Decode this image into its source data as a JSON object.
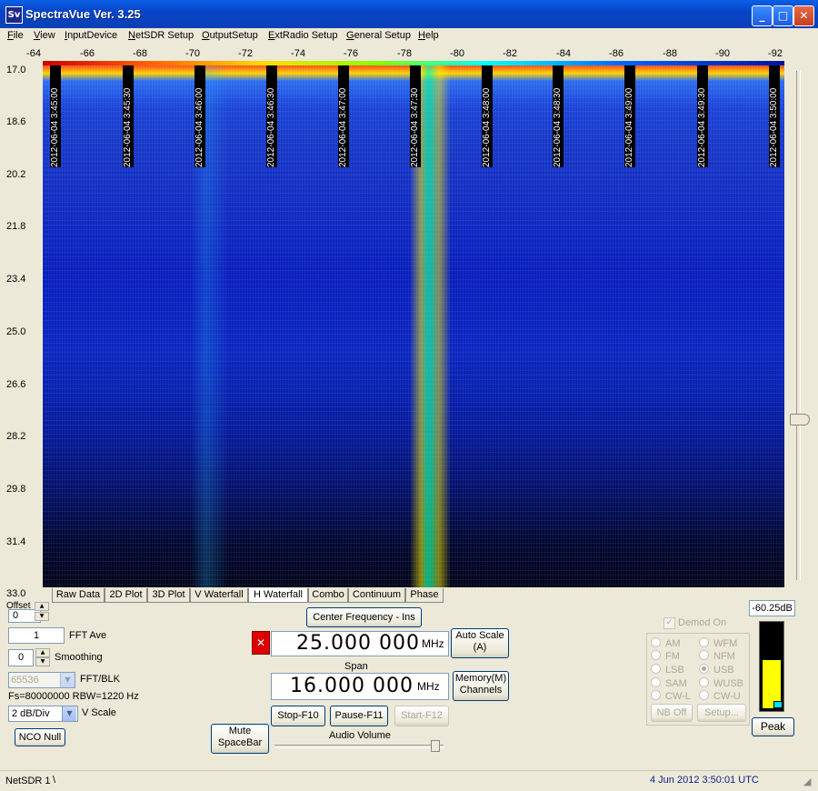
{
  "window": {
    "title": "SpectraVue Ver. 3.25",
    "icon_text": "Sv"
  },
  "menu": [
    "File",
    "View",
    "InputDevice",
    "NetSDR Setup",
    "OutputSetup",
    "ExtRadio Setup",
    "General Setup",
    "Help"
  ],
  "x_axis": {
    "ticks": [
      "-64",
      "-66",
      "-68",
      "-70",
      "-72",
      "-74",
      "-76",
      "-78",
      "-80",
      "-82",
      "-84",
      "-86",
      "-88",
      "-90",
      "-92"
    ]
  },
  "y_axis": {
    "ticks": [
      "17.0",
      "18.6",
      "20.2",
      "21.8",
      "23.4",
      "25.0",
      "26.6",
      "28.2",
      "29.8",
      "31.4",
      "33.0"
    ]
  },
  "timestamps": [
    "2012-06-04 3:45:00",
    "2012-06-04 3:45:30",
    "2012-06-04 3:46:00",
    "2012-06-04 3:46:30",
    "2012-06-04 3:47:00",
    "2012-06-04 3:47:30",
    "2012-06-04 3:48:00",
    "2012-06-04 3:48:30",
    "2012-06-04 3:49:00",
    "2012-06-04 3:49:30",
    "2012-06-04 3:50:00"
  ],
  "tabs": [
    "Raw Data",
    "2D Plot",
    "3D Plot",
    "V Waterfall",
    "H Waterfall",
    "Combo",
    "Continuum",
    "Phase"
  ],
  "active_tab": "H Waterfall",
  "controls": {
    "offset_label": "Offset",
    "offset_value": "0",
    "fft_ave_value": "1",
    "fft_ave_label": "FFT Ave",
    "smoothing_value": "0",
    "smoothing_label": "Smoothing",
    "fft_blk_value": "65536",
    "fft_blk_label": "FFT/BLK",
    "fs_info": "Fs=80000000 RBW=1220 Hz",
    "vscale_value": "2 dB/Div",
    "vscale_label": "V Scale",
    "nco_null": "NCO Null",
    "mute_line1": "Mute",
    "mute_line2": "SpaceBar"
  },
  "center": {
    "button": "Center Frequency - Ins",
    "value": "25.000 000",
    "unit": "MHz",
    "span_label": "Span",
    "span_value": "16.000 000",
    "span_unit": "MHz",
    "auto_scale_line1": "Auto Scale",
    "auto_scale_line2": "(A)",
    "memory_line1": "Memory(M)",
    "memory_line2": "Channels",
    "stop": "Stop-F10",
    "pause": "Pause-F11",
    "start": "Start-F12",
    "audio_volume": "Audio Volume"
  },
  "demod": {
    "checkbox": "Demod On",
    "modes_left": [
      "AM",
      "FM",
      "LSB",
      "SAM",
      "CW-L"
    ],
    "modes_right": [
      "WFM",
      "NFM",
      "USB",
      "WUSB",
      "CW-U"
    ],
    "selected": "USB",
    "nb_off": "NB Off",
    "setup": "Setup..."
  },
  "meter": {
    "readout": "-60.25dB",
    "peak": "Peak",
    "level": 0.58
  },
  "status": {
    "left": "NetSDR 1",
    "right": "4 Jun 2012  3:50:01 UTC"
  }
}
